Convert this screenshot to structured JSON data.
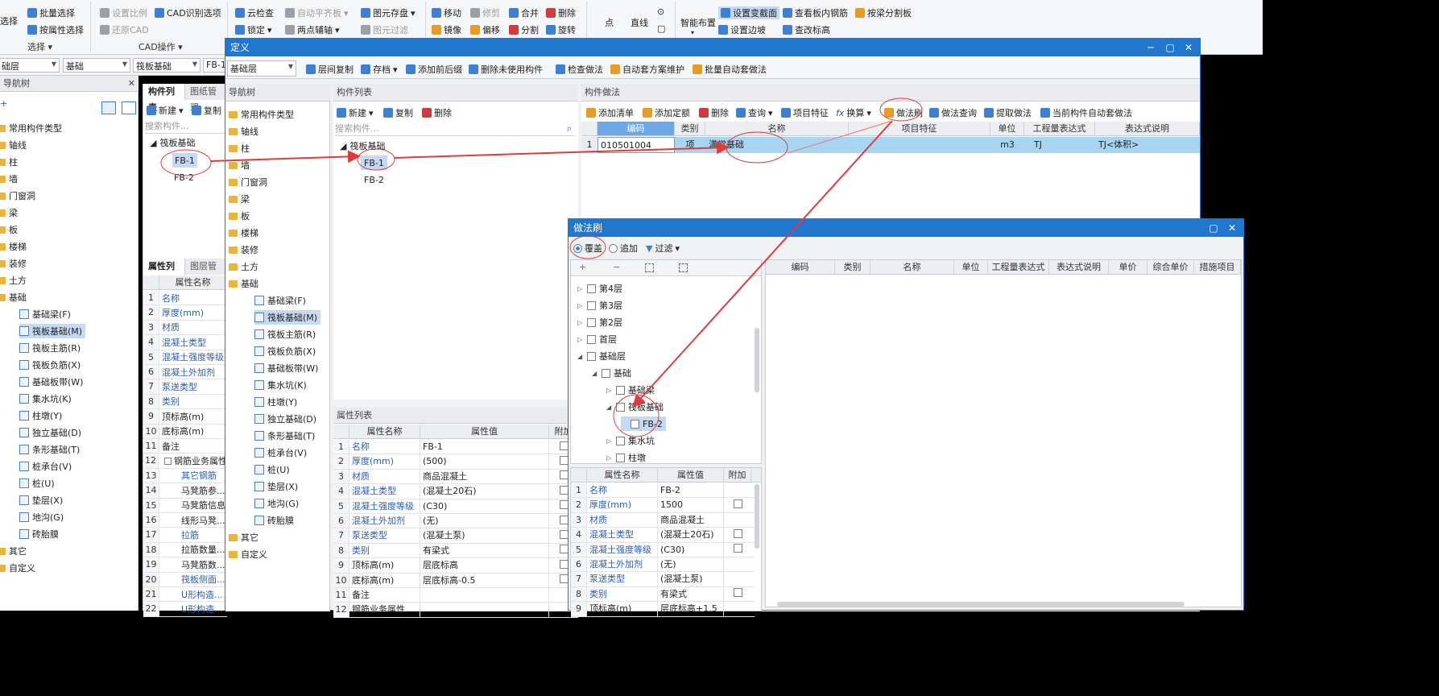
{
  "ribbon": {
    "select_label": "选择",
    "batch_select": "批量选择",
    "prop_select": "按属性选择",
    "select_group": "选择",
    "set_scale": "设置比例",
    "restore_cad": "还原CAD",
    "cad_recognize": "CAD识别选项",
    "cad_group": "CAD操作",
    "cloud_check": "云检查",
    "auto_flat": "自动平齐板",
    "lock": "锁定",
    "two_point": "两点辅轴",
    "elem_save": "图元存盘",
    "elem_filter": "图元过滤",
    "move": "移动",
    "modify": "修剪",
    "mirror": "镜像",
    "offset": "偏移",
    "merge": "合并",
    "split": "分割",
    "delete": "删除",
    "rotate": "旋转",
    "point": "点",
    "line": "直线",
    "smart_layout": "智能布置",
    "set_section": "设置变截面",
    "set_edge": "设置边坡",
    "view_rebar": "查看板内钢筋",
    "modify_elev": "查改标高",
    "beam_split": "按梁分割板"
  },
  "mainbar": {
    "layer": "础层",
    "type": "基础",
    "comp": "筏板基础",
    "name": "FB-1"
  },
  "leftnav": {
    "title": "导航树",
    "items": [
      "常用构件类型",
      "轴线",
      "柱",
      "墙",
      "门窗洞",
      "梁",
      "板",
      "楼梯",
      "装修",
      "土方",
      "基础"
    ],
    "sub": [
      "基础梁(F)",
      "筏板基础(M)",
      "筏板主筋(R)",
      "筏板负筋(X)",
      "基础板带(W)",
      "集水坑(K)",
      "柱墩(Y)",
      "独立基础(D)",
      "条形基础(T)",
      "桩承台(V)",
      "桩(U)",
      "垫层(X)",
      "地沟(G)",
      "砖胎膜"
    ],
    "tail": [
      "其它",
      "自定义"
    ]
  },
  "leftcomp": {
    "tab1": "构件列表",
    "tab2": "图纸管理",
    "new": "新建",
    "copy": "复制",
    "search": "搜索构件...",
    "group": "筏板基础",
    "items": [
      "FB-1",
      "FB-2"
    ]
  },
  "leftprop": {
    "tab1": "属性列表",
    "tab2": "图层管理",
    "col": "属性名称",
    "rows": [
      "名称",
      "厚度(mm)",
      "材质",
      "混凝土类型",
      "混凝土强度等级",
      "混凝土外加剂",
      "泵送类型",
      "类别",
      "顶标高(m)",
      "底标高(m)",
      "备注",
      "钢筋业务属性",
      "其它钢筋",
      "马凳筋参...",
      "马凳筋信息",
      "线形马凳...",
      "拉筋",
      "拉筋数量...",
      "马凳筋数...",
      "筏板侧面...",
      "U形构造...",
      "U形构造..."
    ]
  },
  "def": {
    "title": "定义",
    "layer": "基础层",
    "copy_layer": "层间复制",
    "save": "存档",
    "add_prefix": "添加前后缀",
    "del_unused": "删除未使用构件",
    "check": "检查做法",
    "auto_maint": "自动套方案维护",
    "batch_auto": "批量自动套做法",
    "nav": {
      "title": "导航树",
      "items": [
        "常用构件类型",
        "轴线",
        "柱",
        "墙",
        "门窗洞",
        "梁",
        "板",
        "楼梯",
        "装修",
        "土方",
        "基础"
      ],
      "sub": [
        "基础梁(F)",
        "筏板基础(M)",
        "筏板主筋(R)",
        "筏板负筋(X)",
        "基础板带(W)",
        "集水坑(K)",
        "柱墩(Y)",
        "独立基础(D)",
        "条形基础(T)",
        "桩承台(V)",
        "桩(U)",
        "垫层(X)",
        "地沟(G)",
        "砖胎膜"
      ],
      "tail": [
        "其它",
        "自定义"
      ]
    },
    "comp": {
      "title": "构件列表",
      "new": "新建",
      "copy": "复制",
      "delete": "删除",
      "search": "搜索构件...",
      "group": "筏板基础",
      "items": [
        "FB-1",
        "FB-2"
      ]
    },
    "prop": {
      "title": "属性列表",
      "c1": "属性名称",
      "c2": "属性值",
      "c3": "附加",
      "rows": [
        [
          "名称",
          "FB-1"
        ],
        [
          "厚度(mm)",
          "(500)"
        ],
        [
          "材质",
          "商品混凝土"
        ],
        [
          "混凝土类型",
          "(混凝土20石)"
        ],
        [
          "混凝土强度等级",
          "(C30)"
        ],
        [
          "混凝土外加剂",
          "(无)"
        ],
        [
          "泵送类型",
          "(混凝土泵)"
        ],
        [
          "类别",
          "有梁式"
        ],
        [
          "顶标高(m)",
          "层底标高"
        ],
        [
          "底标高(m)",
          "层底标高-0.5"
        ],
        [
          "备注",
          ""
        ],
        [
          "钢筋业务属性",
          ""
        ]
      ]
    },
    "method": {
      "title": "构件做法",
      "add_list": "添加清单",
      "add_quota": "添加定额",
      "delete": "删除",
      "query": "查询",
      "feature": "项目特征",
      "convert": "换算",
      "brush": "做法刷",
      "mquery": "做法查询",
      "extract": "提取做法",
      "cur_auto": "当前构件自动套做法",
      "cols": [
        "编码",
        "类别",
        "名称",
        "项目特征",
        "单位",
        "工程量表达式",
        "表达式说明"
      ],
      "row": {
        "n": "1",
        "code": "010501004",
        "cat": "项",
        "name": "满堂基础",
        "feat": "",
        "unit": "m3",
        "expr": "TJ",
        "desc": "TJ<体积>"
      }
    }
  },
  "brush": {
    "title": "做法刷",
    "cover": "覆盖",
    "append": "追加",
    "filter": "过滤",
    "cols": [
      "编码",
      "类别",
      "名称",
      "单位",
      "工程量表达式",
      "表达式说明",
      "单价",
      "综合单价",
      "措施项目"
    ],
    "tree": [
      "第4层",
      "第3层",
      "第2层",
      "首层",
      "基础层",
      "基础",
      "基础梁",
      "筏板基础",
      "FB-2",
      "集水坑",
      "柱墩"
    ],
    "prop": {
      "c1": "属性名称",
      "c2": "属性值",
      "c3": "附加",
      "rows": [
        [
          "名称",
          "FB-2"
        ],
        [
          "厚度(mm)",
          "1500"
        ],
        [
          "材质",
          "商品混凝土"
        ],
        [
          "混凝土类型",
          "(混凝土20石)"
        ],
        [
          "混凝土强度等级",
          "(C30)"
        ],
        [
          "混凝土外加剂",
          "(无)"
        ],
        [
          "泵送类型",
          "(混凝土泵)"
        ],
        [
          "类别",
          "有梁式"
        ],
        [
          "顶标高(m)",
          "层底标高+1.5"
        ]
      ]
    }
  }
}
